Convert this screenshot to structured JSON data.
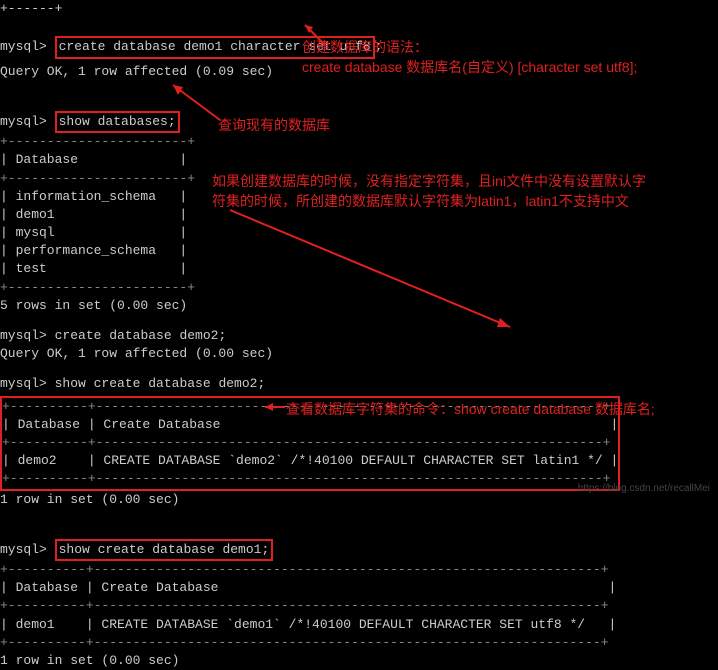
{
  "lines": {
    "l0": "+------+",
    "prompt": "mysql>",
    "cmd1": "create database demo1 character set utf8",
    "semi": ";",
    "q1": "Query OK, 1 row affected (0.09 sec)",
    "cmd2": "show databases;",
    "db_top": "+-----------------------+",
    "db_hdr": "| Database             |",
    "db_r1": "| information_schema   |",
    "db_r2": "| demo1                |",
    "db_r3": "| mysql                |",
    "db_r4": "| performance_schema   |",
    "db_r5": "| test                 |",
    "rows5": "5 rows in set (0.00 sec)",
    "cmd3": "create database demo2;",
    "q2": "Query OK, 1 row affected (0.00 sec)",
    "cmd4": "show create database demo2;",
    "t2_top": "+----------+-----------------------------------------------------------------+",
    "t2_hdr": "| Database | Create Database                                                  |",
    "t2_row": "| demo2    | CREATE DATABASE `demo2` /*!40100 DEFAULT CHARACTER SET latin1 */ |",
    "row1": "1 row in set (0.00 sec)",
    "cmd5": "show create database demo1;",
    "t3_hdr": "| Database | Create Database                                                  |",
    "t3_row": "| demo1    | CREATE DATABASE `demo1` /*!40100 DEFAULT CHARACTER SET utf8 */   |"
  },
  "annotations": {
    "a1_l1": "创建数据库的语法：",
    "a1_l2": "create database 数据库名(自定义) [character set utf8];",
    "a2": "查询现有的数据库",
    "a3_l1": "如果创建数据库的时候，没有指定字符集，且ini文件中没有设置默认字",
    "a3_l2": "符集的时候，所创建的数据库默认字符集为latin1，latin1不支持中文",
    "a4": "查看数据库字符集的命令：show create database 数据库名;"
  },
  "watermark": "https://blog.csdn.net/recallMei",
  "colors": {
    "red": "#e02020"
  }
}
